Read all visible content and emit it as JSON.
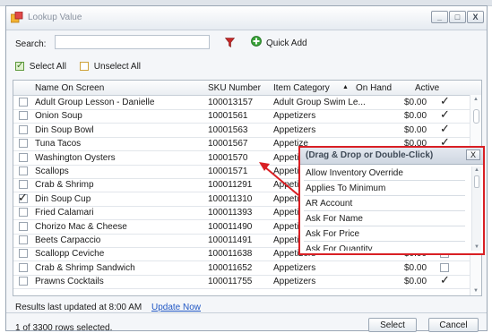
{
  "window": {
    "title": "Lookup Value",
    "controls": [
      "_",
      "□",
      "X"
    ]
  },
  "search": {
    "label": "Search:",
    "value": "",
    "placeholder": ""
  },
  "toolbar": {
    "quick_add": "Quick Add"
  },
  "selection": {
    "select_all": "Select All",
    "unselect_all": "Unselect All"
  },
  "grid": {
    "columns": [
      "Name On Screen",
      "SKU Number",
      "Item Category",
      "On Hand",
      "Active"
    ],
    "rows": [
      {
        "name": "Adult Group Lesson - Danielle",
        "sku": "100013157",
        "category": "Adult Group Swim Le...",
        "onhand": "$0.00",
        "checked": false,
        "active": true
      },
      {
        "name": "Onion Soup",
        "sku": "10001561",
        "category": "Appetizers",
        "onhand": "$0.00",
        "checked": false,
        "active": true
      },
      {
        "name": "Din Soup Bowl",
        "sku": "10001563",
        "category": "Appetizers",
        "onhand": "$0.00",
        "checked": false,
        "active": true
      },
      {
        "name": "Tuna Tacos",
        "sku": "10001567",
        "category": "Appetize",
        "onhand": "$0.00",
        "checked": false,
        "active": true
      },
      {
        "name": "Washington  Oysters",
        "sku": "10001570",
        "category": "Appetize",
        "onhand": "",
        "checked": false,
        "active": false
      },
      {
        "name": "Scallops",
        "sku": "10001571",
        "category": "Appetize",
        "onhand": "",
        "checked": false,
        "active": false
      },
      {
        "name": "Crab & Shrimp",
        "sku": "100011291",
        "category": "Appetize",
        "onhand": "",
        "checked": false,
        "active": false
      },
      {
        "name": "Din Soup Cup",
        "sku": "100011310",
        "category": "Appetize",
        "onhand": "",
        "checked": true,
        "active": false
      },
      {
        "name": "Fried Calamari",
        "sku": "100011393",
        "category": "Appetize",
        "onhand": "",
        "checked": false,
        "active": false
      },
      {
        "name": "Chorizo Mac & Cheese",
        "sku": "100011490",
        "category": "Appetize",
        "onhand": "",
        "checked": false,
        "active": false
      },
      {
        "name": "Beets Carpaccio",
        "sku": "100011491",
        "category": "Appetize",
        "onhand": "",
        "checked": false,
        "active": false
      },
      {
        "name": "Scallopp Ceviche",
        "sku": "100011638",
        "category": "Appetizers",
        "onhand": "$0.00",
        "checked": false,
        "active": false
      },
      {
        "name": "Crab  & Shrimp Sandwich",
        "sku": "100011652",
        "category": "Appetizers",
        "onhand": "$0.00",
        "checked": false,
        "active": false
      },
      {
        "name": "Prawns Cocktails",
        "sku": "100011755",
        "category": "Appetizers",
        "onhand": "$0.00",
        "checked": false,
        "active": true
      }
    ]
  },
  "status": {
    "updated": "Results last updated at 8:00 AM",
    "update_now": "Update Now",
    "selected": "1 of 3300 rows selected."
  },
  "buttons": {
    "select": "Select",
    "cancel": "Cancel"
  },
  "popup": {
    "title": "(Drag & Drop or Double-Click)",
    "close": "X",
    "items": [
      "Allow Inventory Override",
      "Applies To Minimum",
      "AR Account",
      "Ask For Name",
      "Ask For Price",
      "Ask For Quantity"
    ]
  },
  "colors": {
    "annotation": "#d91f24",
    "link": "#1f56c4"
  }
}
